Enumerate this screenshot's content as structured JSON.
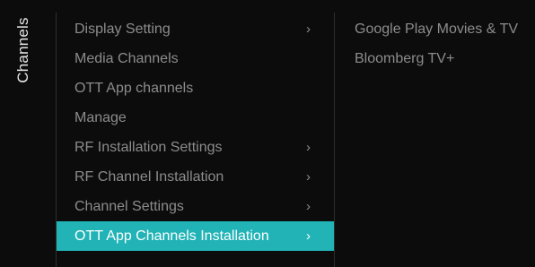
{
  "side_tab": {
    "label": "Channels"
  },
  "menu": {
    "items": [
      {
        "label": "Display Setting",
        "chevron": "›",
        "has_submenu": true,
        "selected": false
      },
      {
        "label": "Media Channels",
        "chevron": "",
        "has_submenu": false,
        "selected": false
      },
      {
        "label": "OTT App channels",
        "chevron": "",
        "has_submenu": false,
        "selected": false
      },
      {
        "label": "Manage",
        "chevron": "",
        "has_submenu": false,
        "selected": false
      },
      {
        "label": "RF Installation Settings",
        "chevron": "›",
        "has_submenu": true,
        "selected": false
      },
      {
        "label": "RF Channel Installation",
        "chevron": "›",
        "has_submenu": true,
        "selected": false
      },
      {
        "label": "Channel Settings",
        "chevron": "›",
        "has_submenu": true,
        "selected": false
      },
      {
        "label": "OTT App Channels Installation",
        "chevron": "›",
        "has_submenu": true,
        "selected": true
      }
    ]
  },
  "submenu": {
    "items": [
      {
        "label": "Google Play Movies & TV"
      },
      {
        "label": "Bloomberg TV+"
      }
    ]
  },
  "colors": {
    "background": "#0c0c0c",
    "highlight": "#21b3b6",
    "text_dim": "#8c8c8c",
    "text_bright": "#ffffff"
  }
}
